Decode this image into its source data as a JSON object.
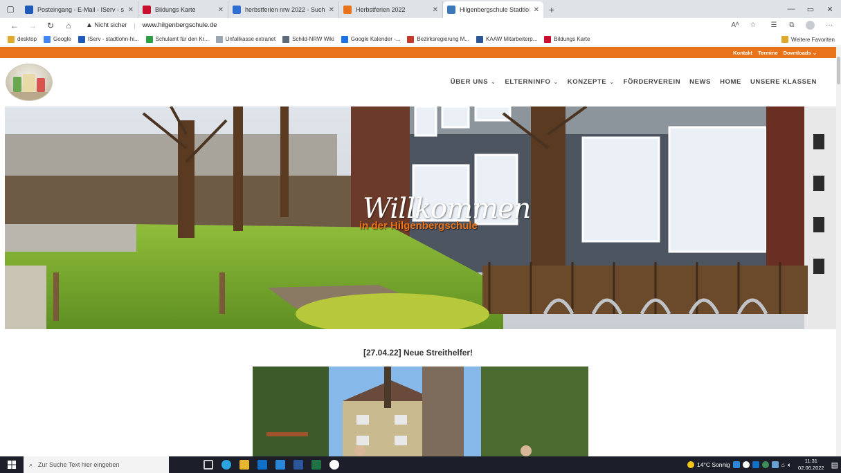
{
  "browser": {
    "tabs": [
      {
        "label": "Posteingang - E-Mail - IServ - sta",
        "color": "#1e5bb8",
        "active": false
      },
      {
        "label": "Bildungs Karte",
        "color": "#c8102e",
        "active": false
      },
      {
        "label": "herbstferien nrw 2022 - Suche",
        "color": "#2f6fd1",
        "active": false
      },
      {
        "label": "Herbstferien 2022",
        "color": "#e8731a",
        "active": false
      },
      {
        "label": "Hilgenbergschule Stadtlohn",
        "color": "#3a78b8",
        "active": true
      }
    ],
    "new_tab": "+",
    "window_controls": {
      "minimize": "—",
      "maximize": "▭",
      "close": "✕"
    },
    "address": {
      "security": "Nicht sicher",
      "url": "www.hilgenbergschule.de"
    },
    "bookmarks": [
      {
        "label": "desktop",
        "color": "#e0a92b"
      },
      {
        "label": "Google",
        "color": "#4285f4"
      },
      {
        "label": "IServ - stadtlohn-hi...",
        "color": "#1e5bb8"
      },
      {
        "label": "Schulamt für den Kr...",
        "color": "#2e9e45"
      },
      {
        "label": "Unfallkasse extranet",
        "color": "#9aa6b3"
      },
      {
        "label": "Schild-NRW Wiki",
        "color": "#5c6b7a"
      },
      {
        "label": "Google Kalender -...",
        "color": "#1a73e8"
      },
      {
        "label": "Bezirksregierung M...",
        "color": "#c0392b"
      },
      {
        "label": "KAAW Mitarbeiterp...",
        "color": "#2b5797"
      },
      {
        "label": "Bildungs Karte",
        "color": "#c8102e"
      }
    ],
    "other_favorites": "Weitere Favoriten"
  },
  "site": {
    "top_links": [
      "Kontakt",
      "Termine",
      "Downloads ⌄"
    ],
    "nav": [
      {
        "label": "ÜBER UNS",
        "dropdown": true
      },
      {
        "label": "ELTERNINFO",
        "dropdown": true
      },
      {
        "label": "KONZEPTE",
        "dropdown": true
      },
      {
        "label": "FÖRDERVEREIN",
        "dropdown": false
      },
      {
        "label": "NEWS",
        "dropdown": false
      },
      {
        "label": "HOME",
        "dropdown": false
      },
      {
        "label": "UNSERE KLASSEN",
        "dropdown": false
      }
    ],
    "hero_title": "Willkommen",
    "hero_subtitle": "in der Hilgenbergschule",
    "post_title": "[27.04.22] Neue Streithelfer!",
    "accent": "#e8731a"
  },
  "taskbar": {
    "search_placeholder": "Zur Suche Text hier eingeben",
    "weather": "14°C Sonnig",
    "time": "11:31",
    "date": "02.06.2022"
  }
}
